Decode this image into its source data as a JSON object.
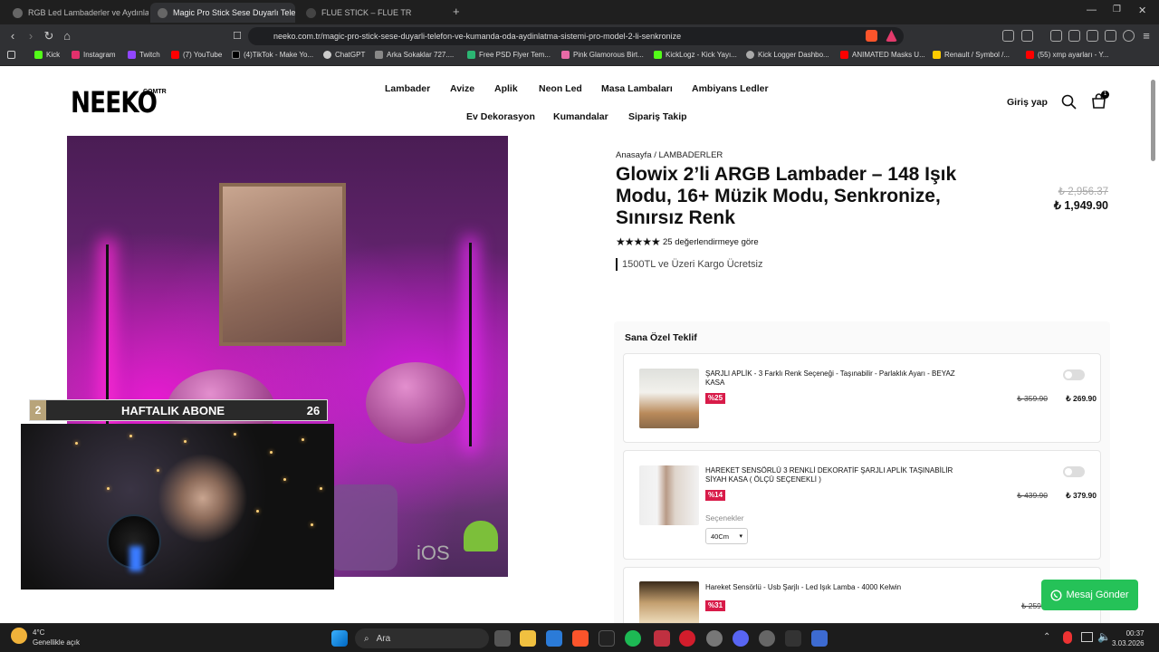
{
  "browser": {
    "tabs": [
      {
        "title": "RGB Led Lambaderler ve Aydınlatma",
        "active": false
      },
      {
        "title": "Magic Pro Stick Sese Duyarlı Telef",
        "active": true
      },
      {
        "title": "FLUE STICK – FLUE TR",
        "active": false
      }
    ],
    "url": "neeko.com.tr/magic-pro-stick-sese-duyarli-telefon-ve-kumanda-oda-aydinlatma-sistemi-pro-model-2-li-senkronize",
    "bookmarks": [
      "Kick",
      "Instagram",
      "Twitch",
      "(7) YouTube",
      "(4)TikTok - Make Yo...",
      "ChatGPT",
      "Arka Sokaklar 727....",
      "Free PSD Flyer Tem...",
      "Pink Glamorous Birt...",
      "KickLogz - Kick Yayı...",
      "Kick Logger Dashbo...",
      "ANIMATED Masks U...",
      "Renault / Symbol /...",
      "(55) xmp ayarları - Y..."
    ]
  },
  "site": {
    "logo": "NEEKO",
    "logo_sub": "COMTR",
    "nav": [
      "Lambader",
      "Avize",
      "Aplik",
      "Neon Led",
      "Masa Lambaları",
      "Ambiyans Ledler",
      "Ev Dekorasyon",
      "Kumandalar",
      "Sipariş Takip"
    ],
    "login": "Giriş yap",
    "cart_count": "1"
  },
  "overlay": {
    "rank": "2",
    "label": "HAFTALIK ABONE",
    "count": "26",
    "ios": "iOS"
  },
  "product": {
    "breadcrumb": "Anasayfa / LAMBADERLER",
    "title": "Glowix 2’li ARGB Lambader – 148 Işık Modu, 16+ Müzik Modu, Senkronize, Sınırsız Renk",
    "old_price": "₺ 2,956.37",
    "price": "₺ 1,949.90",
    "rating": 5,
    "reviews": "25 değerlendirmeye göre",
    "shipping": "1500TL ve Üzeri Kargo Ücretsiz"
  },
  "offers": {
    "title": "Sana Özel Teklif",
    "items": [
      {
        "name": "ŞARJLI APLİK - 3 Farklı Renk Seçeneği - Taşınabilir - Parlaklık Ayarı - BEYAZ KASA",
        "badge": "%25",
        "old": "₺ 359.90",
        "new": "₺ 269.90"
      },
      {
        "name": "HAREKET SENSÖRLÜ 3 RENKLİ DEKORATİF ŞARJLI APLİK TAŞINABİLİR SİYAH KASA ( ÖLÇÜ SEÇENEKLİ )",
        "badge": "%14",
        "old": "₺ 439.90",
        "new": "₺ 379.90",
        "options_label": "Seçenekler",
        "option": "40Cm"
      },
      {
        "name": "Hareket Sensörlü - Usb Şarjlı - Led Işık Lamba - 4000 Kelwin",
        "badge": "%31",
        "old": "₺ 259.9"
      }
    ]
  },
  "whatsapp": "Mesaj Gönder",
  "taskbar": {
    "temp": "4°C",
    "weather": "Genellikle açık",
    "search": "Ara",
    "time": "00:37",
    "date": "3.03.2026"
  }
}
